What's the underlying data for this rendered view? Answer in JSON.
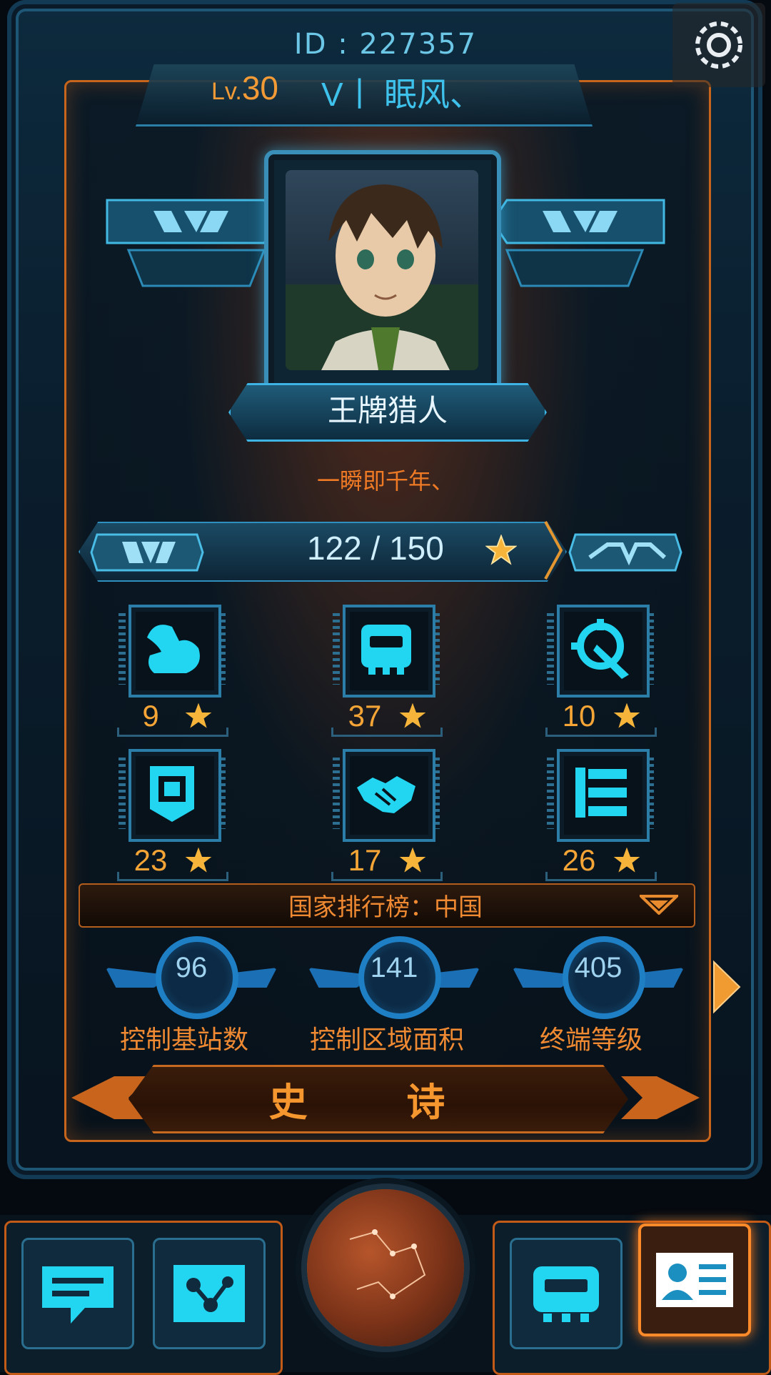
{
  "header": {
    "id_text": "ID : 227357",
    "level_prefix": "Lv.",
    "level_value": "30",
    "vip_mark": "V丨",
    "player_name": "眠风、"
  },
  "profile": {
    "title": "王牌猎人",
    "motto": "一瞬即千年、"
  },
  "stars": {
    "progress_text": "122 / 150",
    "current": 122,
    "max": 150
  },
  "attributes": [
    {
      "icon": "muscle-icon",
      "count": "9"
    },
    {
      "icon": "chip-icon",
      "count": "37"
    },
    {
      "icon": "target-icon",
      "count": "10"
    },
    {
      "icon": "banner-icon",
      "count": "23"
    },
    {
      "icon": "handshake-icon",
      "count": "17"
    },
    {
      "icon": "tree-icon",
      "count": "26"
    }
  ],
  "ranking": {
    "label": "国家排行榜：中国"
  },
  "stats": [
    {
      "value": "96",
      "label": "控制基站数"
    },
    {
      "value": "141",
      "label": "控制区域面积"
    },
    {
      "value": "405",
      "label": "终端等级"
    }
  ],
  "rank_title": "史 诗",
  "nav": {
    "items": [
      "chat-icon",
      "share-icon",
      "chip-icon",
      "id-card-icon",
      "globe-icon"
    ]
  },
  "colors": {
    "accent_orange": "#f29a36",
    "accent_cyan": "#3ec1ea",
    "icon_cyan": "#22d6f2"
  }
}
